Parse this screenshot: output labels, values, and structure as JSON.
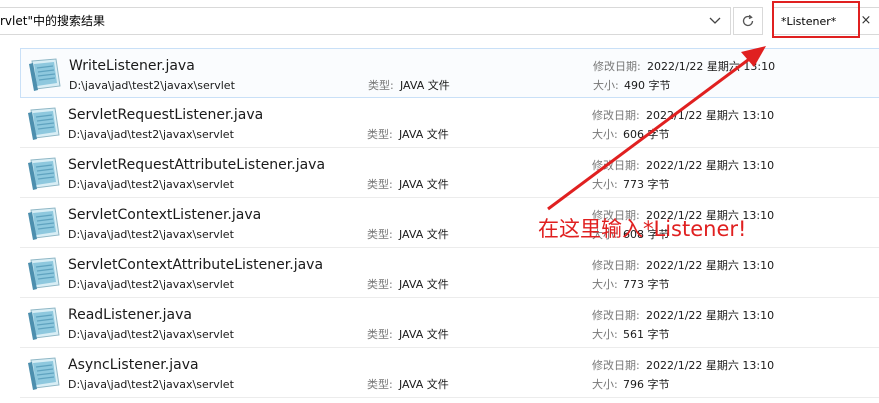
{
  "address_bar": {
    "text": "rvlet\"中的搜索结果"
  },
  "search": {
    "value": "*Listener*",
    "clear_glyph": "×"
  },
  "icons": {
    "dropdown": "chevron-down-icon",
    "refresh": "refresh-icon",
    "clear": "close-icon",
    "file": "java-file-icon"
  },
  "labels": {
    "type": "类型:",
    "date": "修改日期:",
    "size": "大小:"
  },
  "results": [
    {
      "name": "WriteListener.java",
      "path": "D:\\java\\jad\\test2\\javax\\servlet",
      "type": "JAVA 文件",
      "modified": "2022/1/22 星期六 13:10",
      "size": "490 字节",
      "selected": true
    },
    {
      "name": "ServletRequestListener.java",
      "path": "D:\\java\\jad\\test2\\javax\\servlet",
      "type": "JAVA 文件",
      "modified": "2022/1/22 星期六 13:10",
      "size": "606 字节",
      "selected": false
    },
    {
      "name": "ServletRequestAttributeListener.java",
      "path": "D:\\java\\jad\\test2\\javax\\servlet",
      "type": "JAVA 文件",
      "modified": "2022/1/22 星期六 13:10",
      "size": "773 字节",
      "selected": false
    },
    {
      "name": "ServletContextListener.java",
      "path": "D:\\java\\jad\\test2\\javax\\servlet",
      "type": "JAVA 文件",
      "modified": "2022/1/22 星期六 13:10",
      "size": "608 字节",
      "selected": false
    },
    {
      "name": "ServletContextAttributeListener.java",
      "path": "D:\\java\\jad\\test2\\javax\\servlet",
      "type": "JAVA 文件",
      "modified": "2022/1/22 星期六 13:10",
      "size": "773 字节",
      "selected": false
    },
    {
      "name": "ReadListener.java",
      "path": "D:\\java\\jad\\test2\\javax\\servlet",
      "type": "JAVA 文件",
      "modified": "2022/1/22 星期六 13:10",
      "size": "561 字节",
      "selected": false
    },
    {
      "name": "AsyncListener.java",
      "path": "D:\\java\\jad\\test2\\javax\\servlet",
      "type": "JAVA 文件",
      "modified": "2022/1/22 星期六 13:10",
      "size": "796 字节",
      "selected": false
    }
  ],
  "annotation": {
    "text": "在这里输入*Listener!",
    "color": "#e02020"
  },
  "colors": {
    "annotation": "#e02020",
    "selection_border": "#c9e0f7",
    "label_gray": "#777777"
  }
}
